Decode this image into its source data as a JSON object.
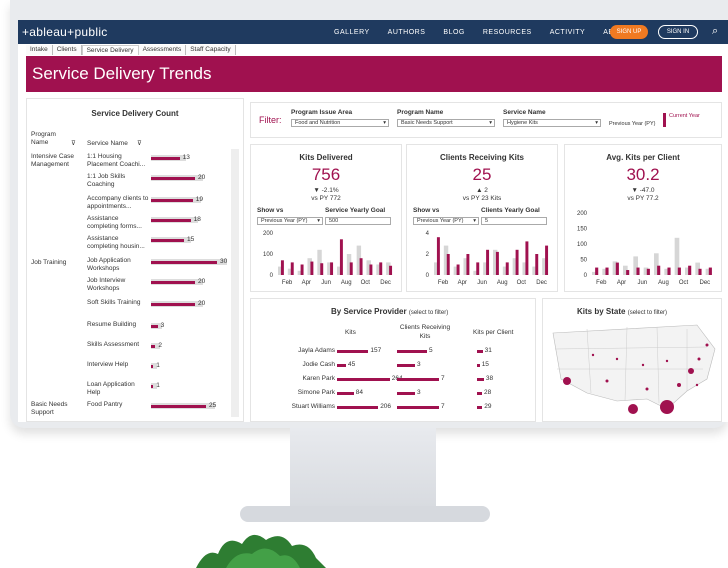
{
  "brand": "+ableau+public",
  "nav": [
    "GALLERY",
    "AUTHORS",
    "BLOG",
    "RESOURCES",
    "ACTIVITY",
    "ABOUT"
  ],
  "signup": "SIGN UP",
  "signin": "SIGN IN",
  "tabs": [
    "Intake",
    "Clients",
    "Service Delivery",
    "Assessments",
    "Staff Capacity"
  ],
  "page_title": "Service Delivery Trends",
  "left_panel": {
    "title": "Service Delivery Count",
    "col1": "Program Name",
    "col2": "Service Name",
    "groups": [
      {
        "program": "Intensive Case Management",
        "rows": [
          {
            "name": "1:1 Housing Placement Coachi...",
            "value": 13
          },
          {
            "name": "1:1 Job Skills Coaching",
            "value": 20
          },
          {
            "name": "Accompany clients to appointments...",
            "value": 19
          },
          {
            "name": "Assistance completing forms...",
            "value": 18
          },
          {
            "name": "Assistance completing housin...",
            "value": 15
          }
        ]
      },
      {
        "program": "Job Training",
        "rows": [
          {
            "name": "Job Application Workshops",
            "value": 30
          },
          {
            "name": "Job Interview Workshops",
            "value": 20
          },
          {
            "name": "Soft Skills Training",
            "value": 20
          },
          {
            "name": "Resume Building",
            "value": 3
          },
          {
            "name": "Skills Assessment",
            "value": 2
          },
          {
            "name": "Interview Help",
            "value": 1
          },
          {
            "name": "Loan Application Help",
            "value": 1
          }
        ]
      },
      {
        "program": "Basic Needs Support",
        "rows": [
          {
            "name": "Food Pantry",
            "value": 25
          }
        ]
      }
    ]
  },
  "filter": {
    "label": "Filter:",
    "f1_label": "Program Issue Area",
    "f1_value": "Food and Nutrition",
    "f2_label": "Program Name",
    "f2_value": "Basic Needs Support",
    "f3_label": "Service Name",
    "f3_value": "Hygiene Kits",
    "legend_prev": "Previous Year (PY)",
    "legend_cur": "Current Year"
  },
  "kpis": [
    {
      "title": "Kits Delivered",
      "value": "756",
      "delta": "▼ -2.1%",
      "py": "vs PY 772",
      "show_label": "Show vs",
      "show_value": "Previous Year (PY)",
      "goal_label": "Service Yearly Goal",
      "goal_value": "500",
      "ticks": [
        "200",
        "100",
        "0"
      ]
    },
    {
      "title": "Clients Receiving Kits",
      "value": "25",
      "delta": "▲ 2",
      "py": "vs PY 23 Kits",
      "show_label": "Show vs",
      "show_value": "Previous Year (PY)",
      "goal_label": "Clients Yearly Goal",
      "goal_value": "5",
      "ticks": [
        "4",
        "2",
        "0"
      ]
    },
    {
      "title": "Avg. Kits per Client",
      "value": "30.2",
      "delta": "▼ -47.0",
      "py": "vs PY 77.2",
      "ticks": [
        "200",
        "150",
        "100",
        "50",
        "0"
      ]
    }
  ],
  "months": [
    "Feb",
    "Apr",
    "Jun",
    "Aug",
    "Oct",
    "Dec"
  ],
  "provider": {
    "title": "By Service Provider",
    "hint": "(select to filter)",
    "cols": [
      "Kits",
      "Clients Receiving Kits",
      "Kits per Client"
    ],
    "rows": [
      {
        "name": "Jayla Adams",
        "kits": 157,
        "clients": 5,
        "kpc": 31
      },
      {
        "name": "Jodie Cash",
        "kits": 45,
        "clients": 3,
        "kpc": 15
      },
      {
        "name": "Karen Park",
        "kits": 264,
        "clients": 7,
        "kpc": 38
      },
      {
        "name": "Simone Park",
        "kits": 84,
        "clients": 3,
        "kpc": 28
      },
      {
        "name": "Stuart Williams",
        "kits": 206,
        "clients": 7,
        "kpc": 29
      }
    ]
  },
  "map": {
    "title": "Kits by State",
    "hint": "(select to filter)"
  },
  "colors": {
    "accent": "#a0114f",
    "nav": "#1f3a5f",
    "signup": "#f07a22"
  }
}
